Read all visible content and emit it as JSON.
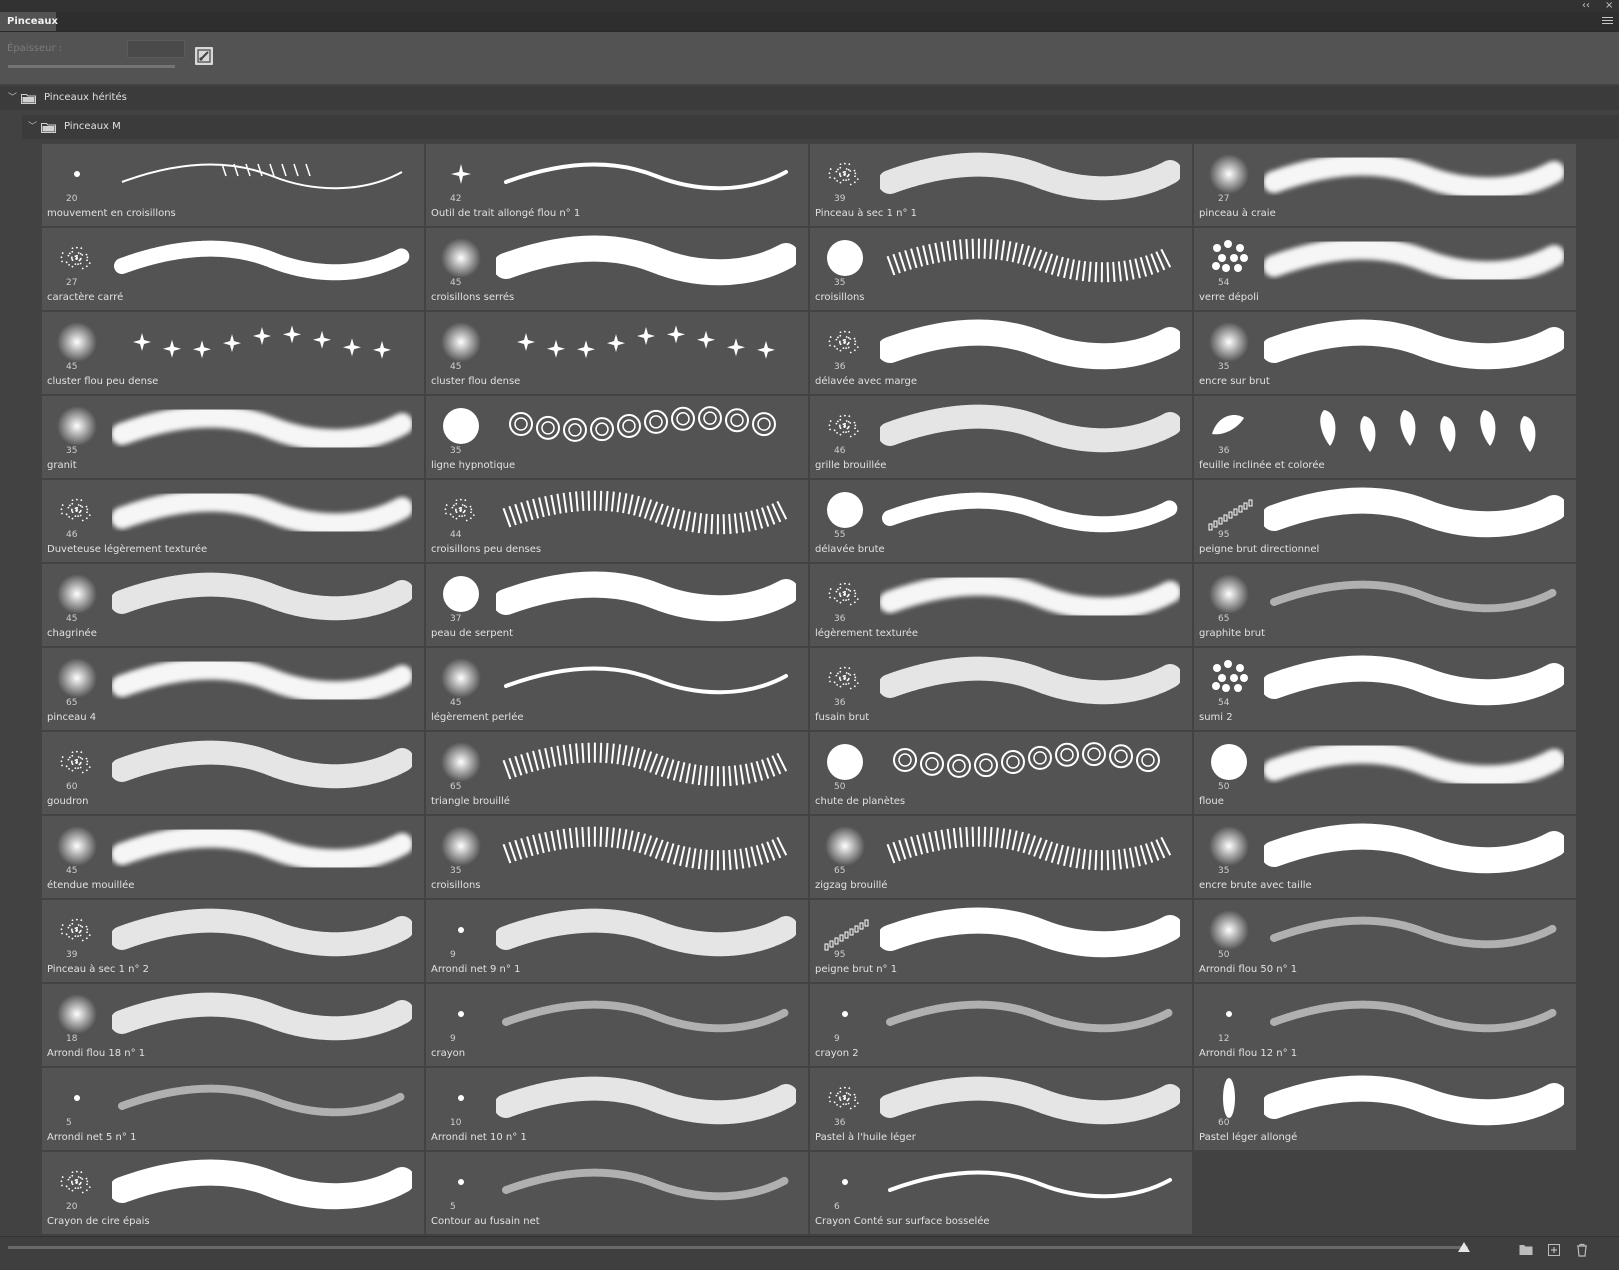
{
  "panel": {
    "title": "Pinceaux",
    "collapse_glyph": "‹‹",
    "close_glyph": "×",
    "menu_icon": "hamburger-menu-icon"
  },
  "toolbar": {
    "size_label": "Épaisseur :",
    "size_value": "",
    "toggle_icon": "brush-settings-icon"
  },
  "tree": {
    "root_folder": "Pinceaux hérités",
    "sub_folder": "Pinceaux M"
  },
  "brushes": [
    {
      "size": "20",
      "name": "mouvement en croisillons",
      "tip": "dot",
      "stroke": "wave"
    },
    {
      "size": "42",
      "name": "Outil de trait allongé flou n° 1",
      "tip": "star",
      "stroke": "thin"
    },
    {
      "size": "39",
      "name": "Pinceau à sec 1 n° 1",
      "tip": "scatter",
      "stroke": "speckle"
    },
    {
      "size": "27",
      "name": "pinceau à craie",
      "tip": "soft",
      "stroke": "soft"
    },
    {
      "size": "27",
      "name": "caractère carré",
      "tip": "scatter",
      "stroke": "rough"
    },
    {
      "size": "45",
      "name": "croisillons serrés",
      "tip": "soft",
      "stroke": "thick"
    },
    {
      "size": "35",
      "name": "croisillons",
      "tip": "hard",
      "stroke": "hatch"
    },
    {
      "size": "54",
      "name": "verre dépoli",
      "tip": "dots",
      "stroke": "soft"
    },
    {
      "size": "45",
      "name": "cluster flou peu dense",
      "tip": "soft",
      "stroke": "stars"
    },
    {
      "size": "45",
      "name": "cluster flou dense",
      "tip": "soft",
      "stroke": "stars"
    },
    {
      "size": "36",
      "name": "délavée avec marge",
      "tip": "scatter",
      "stroke": "thick"
    },
    {
      "size": "35",
      "name": "encre sur brut",
      "tip": "soft",
      "stroke": "thick"
    },
    {
      "size": "35",
      "name": "granit",
      "tip": "soft",
      "stroke": "soft"
    },
    {
      "size": "35",
      "name": "ligne hypnotique",
      "tip": "hard",
      "stroke": "circles"
    },
    {
      "size": "46",
      "name": "grille brouillée",
      "tip": "scatter",
      "stroke": "speckle"
    },
    {
      "size": "36",
      "name": "feuille inclinée et colorée",
      "tip": "leaf",
      "stroke": "leaves"
    },
    {
      "size": "46",
      "name": "Duveteuse légèrement texturée",
      "tip": "scatter",
      "stroke": "soft"
    },
    {
      "size": "44",
      "name": "croisillons peu denses",
      "tip": "scatter",
      "stroke": "hatch"
    },
    {
      "size": "55",
      "name": "délavée brute",
      "tip": "hard",
      "stroke": "rough"
    },
    {
      "size": "95",
      "name": "peigne brut directionnel",
      "tip": "comb",
      "stroke": "thick"
    },
    {
      "size": "45",
      "name": "chagrinée",
      "tip": "soft",
      "stroke": "speckle"
    },
    {
      "size": "37",
      "name": "peau de serpent",
      "tip": "hard",
      "stroke": "thick"
    },
    {
      "size": "36",
      "name": "légèrement texturée",
      "tip": "scatter",
      "stroke": "soft"
    },
    {
      "size": "65",
      "name": "graphite brut",
      "tip": "soft",
      "stroke": "faint"
    },
    {
      "size": "65",
      "name": "pinceau 4",
      "tip": "soft",
      "stroke": "soft"
    },
    {
      "size": "45",
      "name": "légèrement perlée",
      "tip": "soft",
      "stroke": "thin"
    },
    {
      "size": "36",
      "name": "fusain brut",
      "tip": "scatter",
      "stroke": "speckle"
    },
    {
      "size": "54",
      "name": "sumi 2",
      "tip": "dots",
      "stroke": "thick"
    },
    {
      "size": "60",
      "name": "goudron",
      "tip": "scatter",
      "stroke": "speckle"
    },
    {
      "size": "65",
      "name": "triangle brouillé",
      "tip": "soft",
      "stroke": "hatch"
    },
    {
      "size": "50",
      "name": "chute de planètes",
      "tip": "hard",
      "stroke": "circles"
    },
    {
      "size": "50",
      "name": "floue",
      "tip": "hard",
      "stroke": "soft"
    },
    {
      "size": "45",
      "name": "étendue mouillée",
      "tip": "soft",
      "stroke": "soft"
    },
    {
      "size": "35",
      "name": "croisillons",
      "tip": "soft",
      "stroke": "hatch"
    },
    {
      "size": "65",
      "name": "zigzag brouillé",
      "tip": "soft",
      "stroke": "hatch"
    },
    {
      "size": "35",
      "name": "encre brute avec taille",
      "tip": "soft",
      "stroke": "thick"
    },
    {
      "size": "39",
      "name": "Pinceau à sec 1 n° 2",
      "tip": "scatter",
      "stroke": "speckle"
    },
    {
      "size": "9",
      "name": "Arrondi net 9 n° 1",
      "tip": "dot",
      "stroke": "speckle"
    },
    {
      "size": "95",
      "name": "peigne brut n° 1",
      "tip": "comb",
      "stroke": "thick"
    },
    {
      "size": "50",
      "name": "Arrondi flou 50 n° 1",
      "tip": "soft",
      "stroke": "faint"
    },
    {
      "size": "18",
      "name": "Arrondi flou 18 n° 1",
      "tip": "soft",
      "stroke": "speckle"
    },
    {
      "size": "9",
      "name": "crayon",
      "tip": "dot",
      "stroke": "faint"
    },
    {
      "size": "9",
      "name": "crayon 2",
      "tip": "dot",
      "stroke": "faint"
    },
    {
      "size": "12",
      "name": "Arrondi flou 12 n° 1",
      "tip": "dot",
      "stroke": "faint"
    },
    {
      "size": "5",
      "name": "Arrondi net 5 n° 1",
      "tip": "dot",
      "stroke": "faint"
    },
    {
      "size": "10",
      "name": "Arrondi net 10 n° 1",
      "tip": "dot",
      "stroke": "speckle"
    },
    {
      "size": "36",
      "name": "Pastel à l'huile léger",
      "tip": "scatter",
      "stroke": "speckle"
    },
    {
      "size": "60",
      "name": "Pastel léger allongé",
      "tip": "oval",
      "stroke": "thick"
    },
    {
      "size": "20",
      "name": "Crayon de cire épais",
      "tip": "scatter",
      "stroke": "thick"
    },
    {
      "size": "5",
      "name": "Contour au fusain net",
      "tip": "dot",
      "stroke": "faint"
    },
    {
      "size": "6",
      "name": "Crayon Conté sur surface bosselée",
      "tip": "dot",
      "stroke": "thin"
    }
  ],
  "bottom_bar": {
    "zoom_icon": "zoom-thumb-icon",
    "new_group_icon": "folder-icon",
    "new_brush_icon": "add-icon",
    "delete_icon": "trash-icon"
  }
}
